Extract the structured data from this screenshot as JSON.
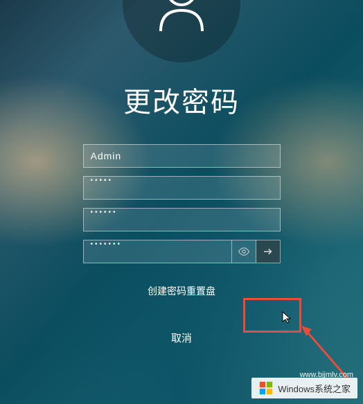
{
  "title": "更改密码",
  "avatar": {
    "icon": "person-icon"
  },
  "fields": {
    "username": {
      "value": "Admin"
    },
    "old_password": {
      "masked": "•••••"
    },
    "new_password": {
      "masked": "••••••"
    },
    "confirm_password": {
      "masked": "•••••••"
    }
  },
  "buttons": {
    "reveal": "eye-icon",
    "submit": "arrow-right-icon",
    "reset_link": "创建密码重置盘",
    "cancel": "取消"
  },
  "watermark": {
    "brand": "Windows系统之家",
    "url": "www.bjjmlv.com"
  }
}
